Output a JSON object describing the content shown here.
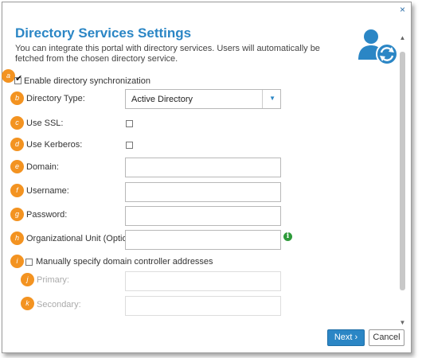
{
  "dialog": {
    "close_label": "×",
    "title": "Directory Services Settings",
    "description": "You can integrate this portal with directory services. Users will automatically be fetched from the chosen directory service."
  },
  "badges": {
    "a": "a",
    "b": "b",
    "c": "c",
    "d": "d",
    "e": "e",
    "f": "f",
    "g": "g",
    "h": "h",
    "i": "i",
    "j": "j",
    "k": "k"
  },
  "form": {
    "enable_sync_label": "Enable directory synchronization",
    "enable_sync_checked": true,
    "directory_type_label": "Directory Type:",
    "directory_type_value": "Active Directory",
    "use_ssl_label": "Use SSL:",
    "use_kerberos_label": "Use Kerberos:",
    "domain_label": "Domain:",
    "username_label": "Username:",
    "password_label": "Password:",
    "ou_label": "Organizational Unit (Optional):",
    "manual_dc_label": "Manually specify domain controller addresses",
    "primary_label": "Primary:",
    "secondary_label": "Secondary:"
  },
  "buttons": {
    "next": "Next ›",
    "cancel": "Cancel"
  },
  "colors": {
    "accent": "#2b86c5",
    "badge": "#f39321",
    "info": "#2e9a3a"
  }
}
